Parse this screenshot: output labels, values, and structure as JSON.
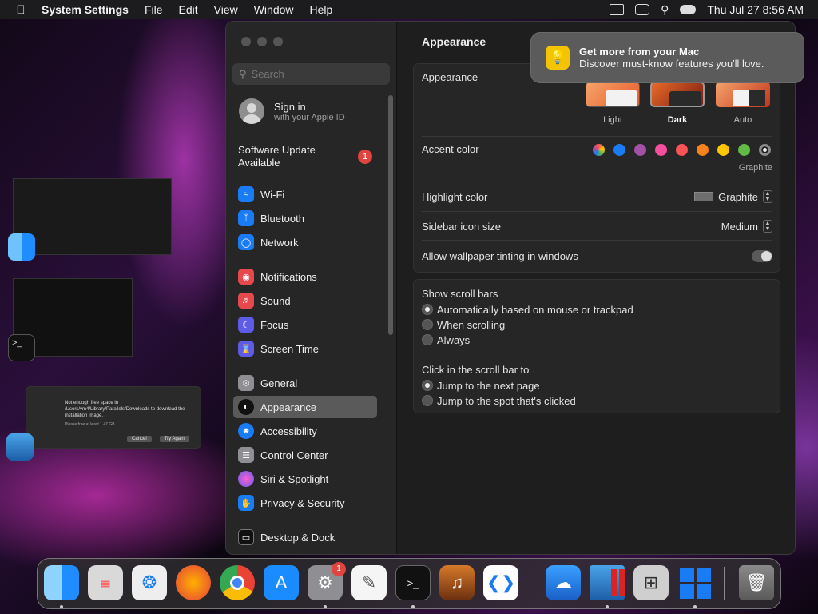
{
  "menubar": {
    "app_name": "System Settings",
    "menus": [
      "File",
      "Edit",
      "View",
      "Window",
      "Help"
    ],
    "clock": "Thu Jul 27  8:56 AM"
  },
  "desktop": {
    "dialog_text": "Not enough free space in /Users/vm4/Library/Parallels/Downloads to download the installation image.",
    "dialog_subtext": "Please free at least 1.47 GB",
    "dialog_cancel": "Cancel",
    "dialog_retry": "Try Again"
  },
  "sidebar": {
    "search_placeholder": "Search",
    "sign_in": {
      "title": "Sign in",
      "subtitle": "with your Apple ID"
    },
    "software_update": {
      "line1": "Software Update",
      "line2": "Available",
      "badge": "1"
    },
    "items": [
      {
        "label": "Wi-Fi",
        "icon": "wifi-icon",
        "color": "#1a7cf5"
      },
      {
        "label": "Bluetooth",
        "icon": "bluetooth-icon",
        "color": "#1a7cf5"
      },
      {
        "label": "Network",
        "icon": "globe-icon",
        "color": "#1a7cf5"
      },
      {
        "label": "Notifications",
        "icon": "bell-icon",
        "color": "#e5484d"
      },
      {
        "label": "Sound",
        "icon": "speaker-icon",
        "color": "#e5484d"
      },
      {
        "label": "Focus",
        "icon": "moon-icon",
        "color": "#5e5ce6"
      },
      {
        "label": "Screen Time",
        "icon": "hourglass-icon",
        "color": "#5e5ce6"
      },
      {
        "label": "General",
        "icon": "gear-icon",
        "color": "#8e8e93"
      },
      {
        "label": "Appearance",
        "icon": "appearance-icon",
        "color": "#111111"
      },
      {
        "label": "Accessibility",
        "icon": "accessibility-icon",
        "color": "#1a7cf5"
      },
      {
        "label": "Control Center",
        "icon": "control-center-icon",
        "color": "#8e8e93"
      },
      {
        "label": "Siri & Spotlight",
        "icon": "siri-icon",
        "color": "#b84fd6"
      },
      {
        "label": "Privacy & Security",
        "icon": "hand-icon",
        "color": "#1a7cf5"
      },
      {
        "label": "Desktop & Dock",
        "icon": "dock-icon",
        "color": "#111111"
      }
    ],
    "selected": "Appearance"
  },
  "content": {
    "title": "Appearance",
    "appearance": {
      "label": "Appearance",
      "options": [
        "Light",
        "Dark",
        "Auto"
      ],
      "selected": "Dark"
    },
    "accent": {
      "label": "Accent color",
      "colors": [
        "#c86bd8",
        "#1a7cf5",
        "#a550a7",
        "#f74f9e",
        "#ff5257",
        "#f7821b",
        "#ffc600",
        "#62ba46",
        "#8c8c8c"
      ],
      "selected_name": "Graphite"
    },
    "highlight": {
      "label": "Highlight color",
      "value": "Graphite",
      "swatch": "#6e6e6e"
    },
    "sidebar_icon_size": {
      "label": "Sidebar icon size",
      "value": "Medium"
    },
    "wallpaper_tinting": {
      "label": "Allow wallpaper tinting in windows",
      "enabled": false
    },
    "scroll_bars": {
      "label": "Show scroll bars",
      "options": [
        "Automatically based on mouse or trackpad",
        "When scrolling",
        "Always"
      ],
      "selected": "Automatically based on mouse or trackpad"
    },
    "click_scroll": {
      "label": "Click in the scroll bar to",
      "options": [
        "Jump to the next page",
        "Jump to the spot that's clicked"
      ],
      "selected": "Jump to the next page"
    },
    "help": "?"
  },
  "notification": {
    "title": "Get more from your Mac",
    "body": "Discover must-know features you'll love."
  },
  "dock": {
    "apps": [
      "Finder",
      "Launchpad",
      "Safari",
      "Firefox",
      "Chrome",
      "App Store",
      "System Settings",
      "TextEdit",
      "Terminal",
      "GarageBand",
      "Visual Studio Code",
      "Weather",
      "Parallels Desktop",
      "Boot Camp Assistant",
      "Windows",
      "Trash"
    ],
    "settings_badge": "1"
  }
}
